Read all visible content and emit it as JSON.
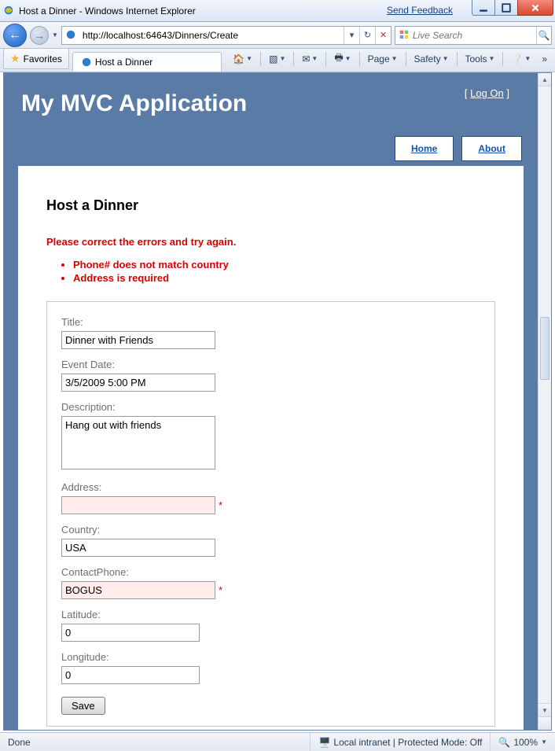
{
  "window": {
    "title": "Host a Dinner - Windows Internet Explorer",
    "feedback": "Send Feedback"
  },
  "nav": {
    "url": "http://localhost:64643/Dinners/Create",
    "search_placeholder": "Live Search"
  },
  "tabs": {
    "favorites": "Favorites",
    "tab1": "Host a Dinner"
  },
  "menu": {
    "page": "Page",
    "safety": "Safety",
    "tools": "Tools"
  },
  "app": {
    "title": "My MVC Application",
    "logon": "Log On",
    "nav_home": "Home",
    "nav_about": "About"
  },
  "form": {
    "heading": "Host a Dinner",
    "summary": "Please correct the errors and try again.",
    "errors": [
      "Phone# does not match country",
      "Address is required"
    ],
    "labels": {
      "title": "Title:",
      "eventdate": "Event Date:",
      "description": "Description:",
      "address": "Address:",
      "country": "Country:",
      "contactphone": "ContactPhone:",
      "latitude": "Latitude:",
      "longitude": "Longitude:"
    },
    "values": {
      "title": "Dinner with Friends",
      "eventdate": "3/5/2009 5:00 PM",
      "description": "Hang out with friends",
      "address": "",
      "country": "USA",
      "contactphone": "BOGUS",
      "latitude": "0",
      "longitude": "0"
    },
    "save": "Save"
  },
  "status": {
    "done": "Done",
    "zone": "Local intranet | Protected Mode: Off",
    "zoom": "100%"
  }
}
